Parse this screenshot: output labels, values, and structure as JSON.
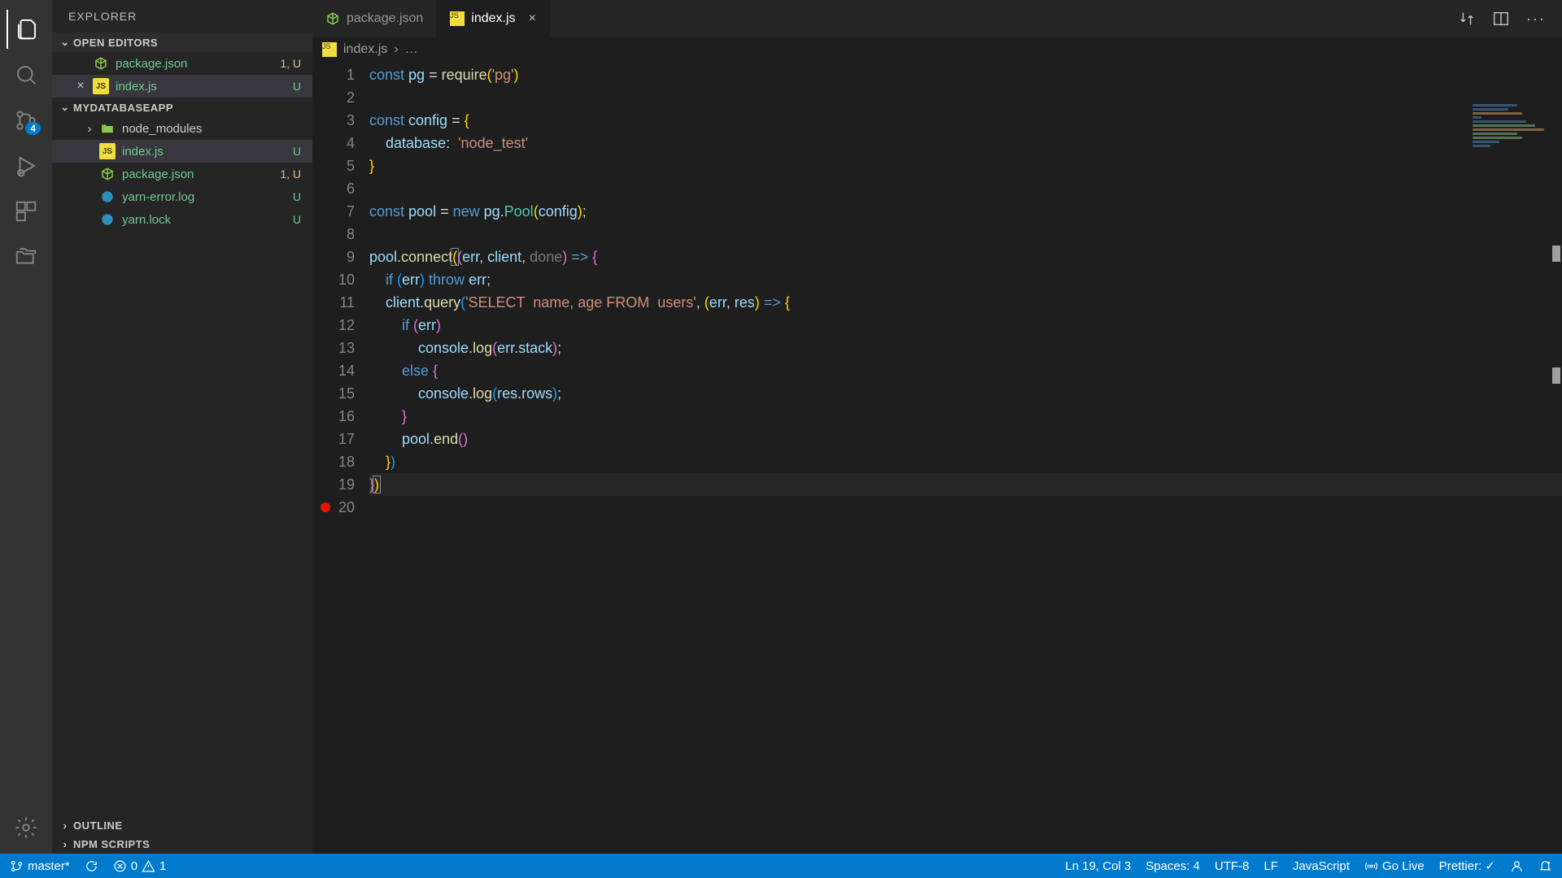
{
  "sidebar": {
    "title": "EXPLORER",
    "sections": {
      "openEditors": "OPEN EDITORS",
      "project": "MYDATABASEAPP",
      "outline": "OUTLINE",
      "npmScripts": "NPM SCRIPTS"
    },
    "openEditorItems": [
      {
        "label": "package.json",
        "status": "1, U",
        "icon": "npm"
      },
      {
        "label": "index.js",
        "status": "U",
        "icon": "js",
        "active": true
      }
    ],
    "projectItems": [
      {
        "label": "node_modules",
        "status": "",
        "icon": "folder",
        "isFolder": true
      },
      {
        "label": "index.js",
        "status": "U",
        "icon": "js",
        "active": true
      },
      {
        "label": "package.json",
        "status": "1, U",
        "icon": "npm"
      },
      {
        "label": "yarn-error.log",
        "status": "U",
        "icon": "yarn"
      },
      {
        "label": "yarn.lock",
        "status": "U",
        "icon": "yarn"
      }
    ]
  },
  "activitybar": {
    "scmBadge": "4"
  },
  "tabs": [
    {
      "label": "package.json",
      "icon": "npm"
    },
    {
      "label": "index.js",
      "icon": "js",
      "active": true
    }
  ],
  "breadcrumb": {
    "file": "index.js",
    "rest": "…"
  },
  "code": {
    "lineCount": 20,
    "lines": [
      [
        [
          "tok-kw",
          "const "
        ],
        [
          "tok-var",
          "pg"
        ],
        [
          "tok-op",
          " = "
        ],
        [
          "tok-fn",
          "require"
        ],
        [
          "bracket-y",
          "("
        ],
        [
          "tok-str",
          "'pg'"
        ],
        [
          "bracket-y",
          ")"
        ]
      ],
      [],
      [
        [
          "tok-kw",
          "const "
        ],
        [
          "tok-var",
          "config"
        ],
        [
          "tok-op",
          " = "
        ],
        [
          "bracket-y",
          "{"
        ]
      ],
      [
        [
          "",
          "    "
        ],
        [
          "tok-prop",
          "database"
        ],
        [
          "tok-punc",
          ":  "
        ],
        [
          "tok-str",
          "'node_test'"
        ]
      ],
      [
        [
          "bracket-y",
          "}"
        ]
      ],
      [],
      [
        [
          "tok-kw",
          "const "
        ],
        [
          "tok-var",
          "pool"
        ],
        [
          "tok-op",
          " = "
        ],
        [
          "tok-kw",
          "new "
        ],
        [
          "tok-var",
          "pg"
        ],
        [
          "tok-punc",
          "."
        ],
        [
          "tok-type",
          "Pool"
        ],
        [
          "bracket-y",
          "("
        ],
        [
          "tok-var",
          "config"
        ],
        [
          "bracket-y",
          ")"
        ],
        [
          "tok-punc",
          ";"
        ]
      ],
      [],
      [
        [
          "tok-var",
          "pool"
        ],
        [
          "tok-punc",
          "."
        ],
        [
          "tok-fn",
          "connect"
        ],
        [
          "bracket-y bracket-match",
          "("
        ],
        [
          "bracket-p",
          "("
        ],
        [
          "tok-param",
          "err"
        ],
        [
          "tok-punc",
          ", "
        ],
        [
          "tok-param",
          "client"
        ],
        [
          "tok-punc",
          ", "
        ],
        [
          "tok-paramfade",
          "done"
        ],
        [
          "bracket-p",
          ")"
        ],
        [
          "tok-kw",
          " => "
        ],
        [
          "bracket-p",
          "{"
        ]
      ],
      [
        [
          "",
          "    "
        ],
        [
          "tok-kw",
          "if"
        ],
        [
          "tok-punc",
          " "
        ],
        [
          "bracket-b",
          "("
        ],
        [
          "tok-var",
          "err"
        ],
        [
          "bracket-b",
          ")"
        ],
        [
          "tok-kw",
          " throw "
        ],
        [
          "tok-var",
          "err"
        ],
        [
          "tok-punc",
          ";"
        ]
      ],
      [
        [
          "",
          "    "
        ],
        [
          "tok-var",
          "client"
        ],
        [
          "tok-punc",
          "."
        ],
        [
          "tok-fn",
          "query"
        ],
        [
          "bracket-b",
          "("
        ],
        [
          "tok-str",
          "'SELECT  name, age FROM  users'"
        ],
        [
          "tok-punc",
          ", "
        ],
        [
          "bracket-y",
          "("
        ],
        [
          "tok-param",
          "err"
        ],
        [
          "tok-punc",
          ", "
        ],
        [
          "tok-param",
          "res"
        ],
        [
          "bracket-y",
          ")"
        ],
        [
          "tok-kw",
          " => "
        ],
        [
          "bracket-y",
          "{"
        ]
      ],
      [
        [
          "",
          "        "
        ],
        [
          "tok-kw",
          "if"
        ],
        [
          "tok-punc",
          " "
        ],
        [
          "bracket-p",
          "("
        ],
        [
          "tok-var",
          "err"
        ],
        [
          "bracket-p",
          ")"
        ]
      ],
      [
        [
          "",
          "            "
        ],
        [
          "tok-var",
          "console"
        ],
        [
          "tok-punc",
          "."
        ],
        [
          "tok-fn",
          "log"
        ],
        [
          "bracket-p",
          "("
        ],
        [
          "tok-var",
          "err"
        ],
        [
          "tok-punc",
          "."
        ],
        [
          "tok-var",
          "stack"
        ],
        [
          "bracket-p",
          ")"
        ],
        [
          "tok-punc",
          ";"
        ]
      ],
      [
        [
          "",
          "        "
        ],
        [
          "tok-kw",
          "else"
        ],
        [
          "tok-punc",
          " "
        ],
        [
          "bracket-p",
          "{"
        ]
      ],
      [
        [
          "",
          "            "
        ],
        [
          "tok-var",
          "console"
        ],
        [
          "tok-punc",
          "."
        ],
        [
          "tok-fn",
          "log"
        ],
        [
          "bracket-b",
          "("
        ],
        [
          "tok-var",
          "res"
        ],
        [
          "tok-punc",
          "."
        ],
        [
          "tok-var",
          "rows"
        ],
        [
          "bracket-b",
          ")"
        ],
        [
          "tok-punc",
          ";"
        ]
      ],
      [
        [
          "",
          "        "
        ],
        [
          "bracket-p",
          "}"
        ]
      ],
      [
        [
          "",
          "        "
        ],
        [
          "tok-var",
          "pool"
        ],
        [
          "tok-punc",
          "."
        ],
        [
          "tok-fn",
          "end"
        ],
        [
          "bracket-p",
          "("
        ],
        [
          "bracket-p",
          ")"
        ]
      ],
      [
        [
          "",
          "    "
        ],
        [
          "bracket-y",
          "}"
        ],
        [
          "bracket-b",
          ")"
        ]
      ],
      [
        [
          "bracket-p",
          "}"
        ],
        [
          "bracket-y bracket-match",
          ")"
        ]
      ],
      []
    ]
  },
  "statusbar": {
    "branch": "master*",
    "errors": "0",
    "warnings": "1",
    "position": "Ln 19, Col 3",
    "spaces": "Spaces: 4",
    "encoding": "UTF-8",
    "eol": "LF",
    "language": "JavaScript",
    "golive": "Go Live",
    "prettier": "Prettier: ✓"
  }
}
